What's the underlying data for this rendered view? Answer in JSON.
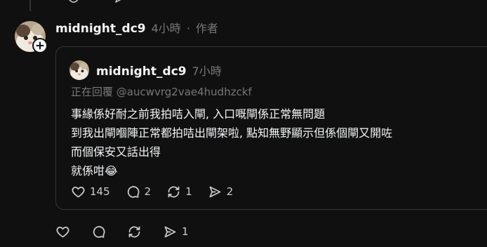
{
  "post": {
    "username": "midnight_dc9",
    "time": "4小時",
    "separator": "·",
    "author_tag": "作者"
  },
  "quote": {
    "username": "midnight_dc9",
    "time": "7小時",
    "replying_to": "正在回覆 @aucwvrg2vae4hudhzckf",
    "lines": [
      "事緣係好耐之前我拍咭入閘, 入口嘅閘係正常無問題",
      "到我出閘嗰陣正常都拍咭出閘架啦, 點知無野顯示但係個閘又開咗",
      "而個保安又話出得",
      "就係咁😂"
    ],
    "actions": {
      "likes": "145",
      "comments": "2",
      "reposts": "1",
      "shares": "2"
    }
  },
  "bottom_actions": {
    "shares": "1"
  },
  "icons": [
    "heart-icon",
    "comment-icon",
    "repost-icon",
    "share-icon",
    "plus-icon"
  ],
  "colors": {
    "background": "#101010",
    "text": "#f3f5f7",
    "muted": "#777777",
    "border": "#333638"
  }
}
